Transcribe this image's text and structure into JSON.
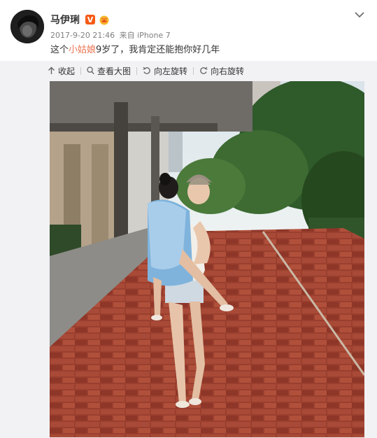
{
  "user": {
    "name": "马伊琍",
    "badge": "V"
  },
  "meta": {
    "time": "2017-9-20 21:46",
    "from_label": "来自",
    "device": "iPhone 7"
  },
  "post": {
    "text_before": "这个",
    "highlight": "小姑娘",
    "text_after": "9岁了，我肯定还能抱你好几年"
  },
  "toolbar": {
    "collapse": "收起",
    "view_large": "查看大图",
    "rotate_left": "向左旋转",
    "rotate_right": "向右旋转"
  },
  "colors": {
    "highlight": "#eb7350",
    "badge": "#f55a14",
    "panel_bg": "#f2f2f5"
  },
  "icons": {
    "badge": "verified-v-icon",
    "member": "member-crown-icon",
    "menu": "chevron-down-icon",
    "collapse": "collapse-arrow-icon",
    "view_large": "magnifier-icon",
    "rotate_left": "rotate-left-icon",
    "rotate_right": "rotate-right-icon"
  }
}
